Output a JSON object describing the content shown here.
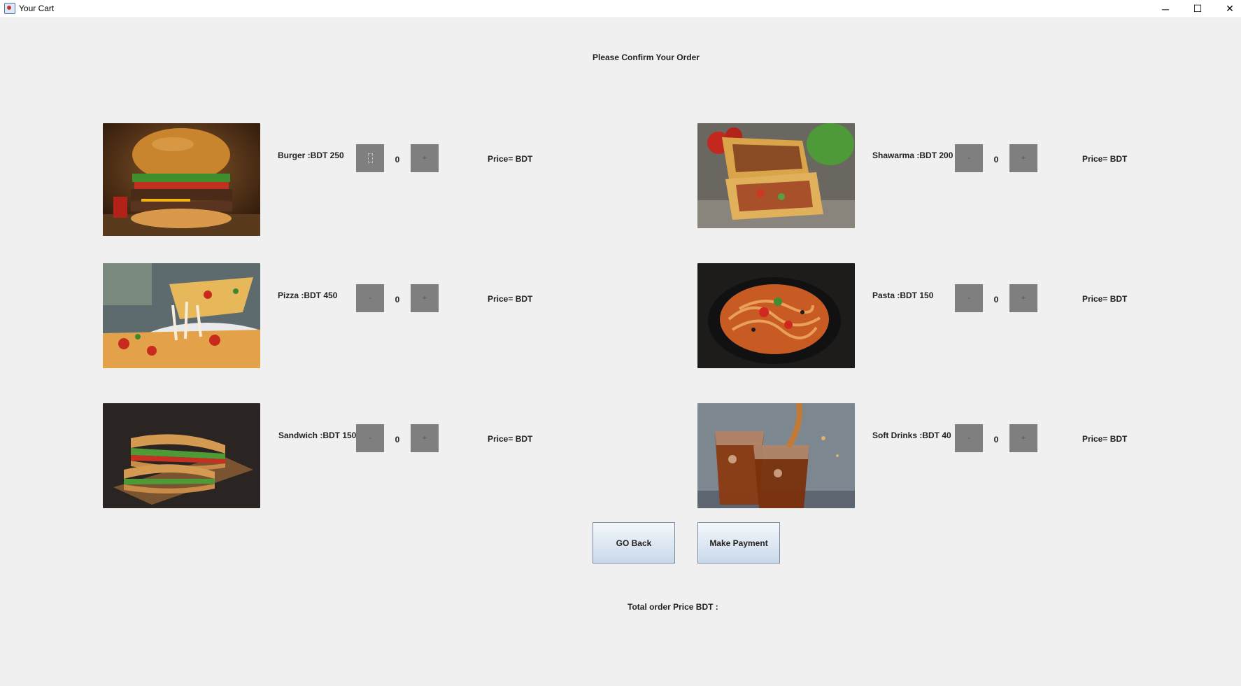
{
  "window": {
    "title": "Your Cart",
    "minimize_icon": "─",
    "maximize_icon": "☐",
    "close_icon": "✕"
  },
  "heading": "Please Confirm Your Order",
  "items": [
    {
      "label": "Burger :BDT 250",
      "minus": "-",
      "qty": "0",
      "plus": "+",
      "price": "Price= BDT"
    },
    {
      "label": "Shawarma :BDT 200",
      "minus": "-",
      "qty": "0",
      "plus": "+",
      "price": "Price= BDT"
    },
    {
      "label": "Pizza :BDT 450",
      "minus": "-",
      "qty": "0",
      "plus": "+",
      "price": "Price= BDT"
    },
    {
      "label": "Pasta :BDT 150",
      "minus": "-",
      "qty": "0",
      "plus": "+",
      "price": "Price= BDT"
    },
    {
      "label": "Sandwich :BDT 150",
      "minus": "-",
      "qty": "0",
      "plus": "+",
      "price": "Price= BDT"
    },
    {
      "label": "Soft Drinks :BDT 40",
      "minus": "-",
      "qty": "0",
      "plus": "+",
      "price": "Price= BDT"
    }
  ],
  "buttons": {
    "go_back": "GO Back",
    "make_payment": "Make Payment"
  },
  "total_label": "Total order Price BDT :"
}
